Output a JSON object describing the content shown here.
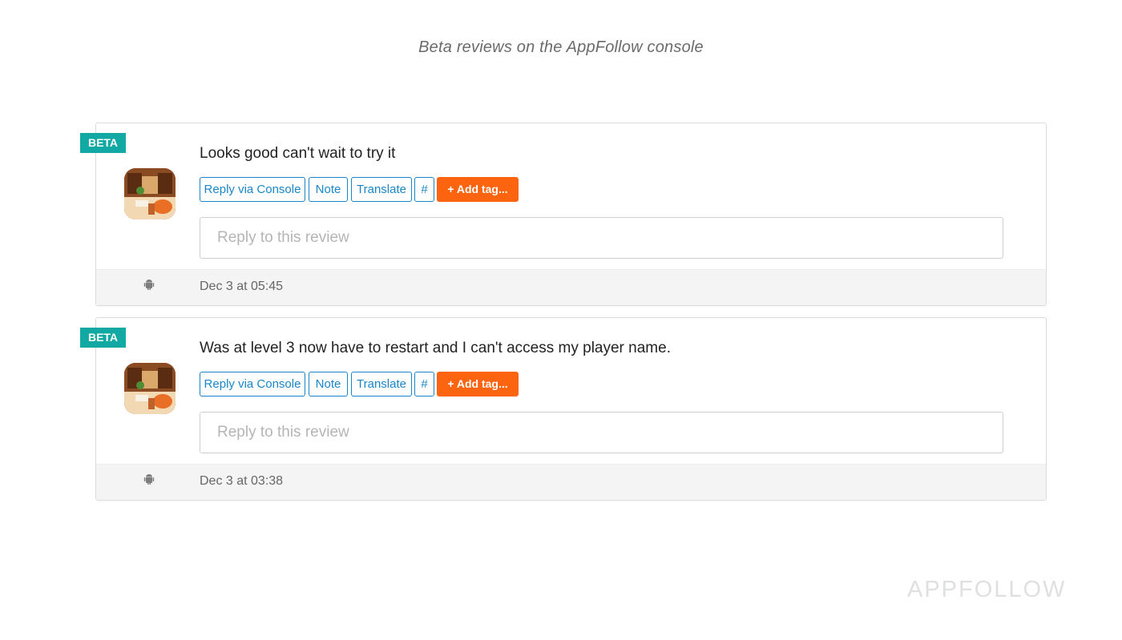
{
  "caption": "Beta reviews on the AppFollow console",
  "reviews": [
    {
      "badge": "BETA",
      "text": "Looks good can't wait to try it",
      "buttons": {
        "reply": "Reply via Console",
        "note": "Note",
        "translate": "Translate",
        "hash": "#",
        "add_tag": "+ Add tag..."
      },
      "reply_placeholder": "Reply to this review",
      "platform_icon": "android-icon",
      "date": "Dec 3 at 05:45"
    },
    {
      "badge": "BETA",
      "text": "Was at level 3 now have to restart and I can't access my player name.",
      "buttons": {
        "reply": "Reply via Console",
        "note": "Note",
        "translate": "Translate",
        "hash": "#",
        "add_tag": "+ Add tag..."
      },
      "reply_placeholder": "Reply to this review",
      "platform_icon": "android-icon",
      "date": "Dec 3 at 03:38"
    }
  ],
  "watermark": "APPFOLLOW",
  "colors": {
    "badge": "#12a8a3",
    "button_outline": "#1a86c8",
    "add_tag": "#fd6410"
  }
}
